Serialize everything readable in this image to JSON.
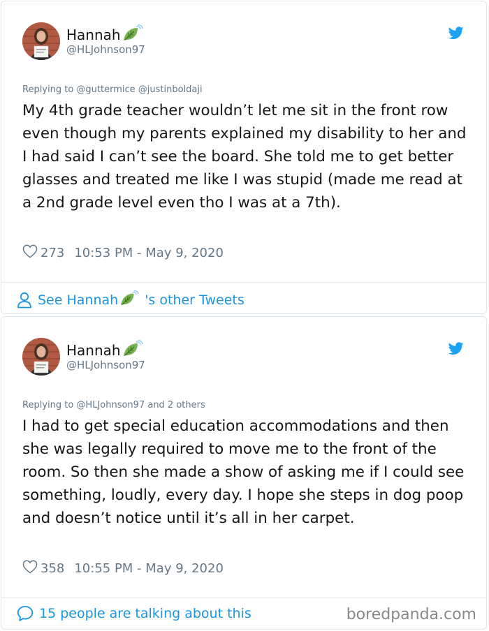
{
  "tweets": [
    {
      "display_name": "Hannah",
      "handle": "@HLJohnson97",
      "replying_to": "Replying to @guttermice @justinboldaji",
      "text": "My 4th grade teacher wouldn’t let me sit in the front row even though my parents explained my disability to her and I had said I can’t see the board. She told me to get better glasses and treated me like I was stupid (made me read at a 2nd grade level even tho I was at a 7th).",
      "likes": "273",
      "timestamp": "10:53 PM - May 9, 2020",
      "footer_prefix": "See Hannah",
      "footer_suffix": "'s other Tweets"
    },
    {
      "display_name": "Hannah",
      "handle": "@HLJohnson97",
      "replying_to": "Replying to @HLJohnson97 and 2 others",
      "text": "I had to get special education accommodations and then she was legally required to move me to the front of the room. So then she made a show of asking me if I could see something, loudly, every day. I hope she steps in dog poop and doesn’t notice until it’s all in her carpet.",
      "likes": "358",
      "timestamp": "10:55 PM - May 9, 2020",
      "footer": "15 people are talking about this"
    }
  ],
  "watermark": "boredpanda.com",
  "icons": {
    "brand": "twitter-bird-icon",
    "like": "heart-icon",
    "profile": "person-icon",
    "conversation": "speech-bubble-icon",
    "emoji": "leaf-emoji-icon"
  },
  "colors": {
    "accent": "#1da1f2",
    "link": "#1b95e0",
    "text": "#14171a",
    "muted": "#657786",
    "border": "#e1e8ed",
    "leaf": "#77b255"
  }
}
